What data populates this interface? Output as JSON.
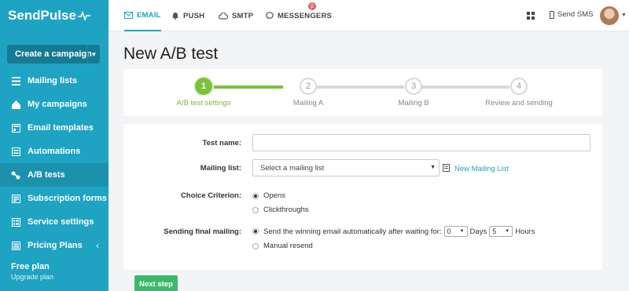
{
  "brand": {
    "name": "SendPulse"
  },
  "sidebar": {
    "create_label": "Create a campaign",
    "items": [
      {
        "label": "Mailing lists",
        "icon": "list-icon"
      },
      {
        "label": "My campaigns",
        "icon": "campaigns-icon"
      },
      {
        "label": "Email templates",
        "icon": "templates-icon"
      },
      {
        "label": "Automations",
        "icon": "automations-icon"
      },
      {
        "label": "A/B tests",
        "icon": "ab-tests-icon"
      },
      {
        "label": "Subscription forms",
        "icon": "forms-icon"
      },
      {
        "label": "Service settings",
        "icon": "settings-icon"
      },
      {
        "label": "Pricing Plans",
        "icon": "pricing-icon"
      }
    ],
    "active_index": 4,
    "plan_title": "Free plan",
    "plan_link": "Upgrade plan"
  },
  "topbar": {
    "tabs": [
      {
        "label": "EMAIL",
        "icon": "envelope-icon"
      },
      {
        "label": "PUSH",
        "icon": "bell-icon"
      },
      {
        "label": "SMTP",
        "icon": "cloud-icon"
      },
      {
        "label": "MESSENGERS",
        "icon": "chat-icon"
      }
    ],
    "messengers_badge": "β",
    "send_sms": "Send SMS"
  },
  "page": {
    "title": "New A/B test"
  },
  "steps": [
    {
      "number": "1",
      "label": "A/B test settings"
    },
    {
      "number": "2",
      "label": "Mailing A"
    },
    {
      "number": "3",
      "label": "Mailing B"
    },
    {
      "number": "4",
      "label": "Review and sending"
    }
  ],
  "current_step": 1,
  "form": {
    "test_name_label": "Test name:",
    "test_name_value": "",
    "mailing_list_label": "Mailing list:",
    "mailing_list_value": "Select a mailing list",
    "new_list_link": "New Mailing List",
    "criterion_label": "Choice Criterion:",
    "criterion_options": [
      "Opens",
      "Clickthroughs"
    ],
    "criterion_selected": "Opens",
    "sending_label": "Sending final mailing:",
    "sending_option_auto": "Send the winning email automatically after waiting for:",
    "days_value": "0",
    "days_label": "Days",
    "hours_value": "5",
    "hours_label": "Hours",
    "sending_option_manual": "Manual resend"
  },
  "actions": {
    "next_label": "Next step"
  },
  "colors": {
    "sidebar": "#1fa3c3",
    "step_active": "#7cc13a",
    "next_button": "#3cba6c",
    "link": "#1fa3c3"
  }
}
